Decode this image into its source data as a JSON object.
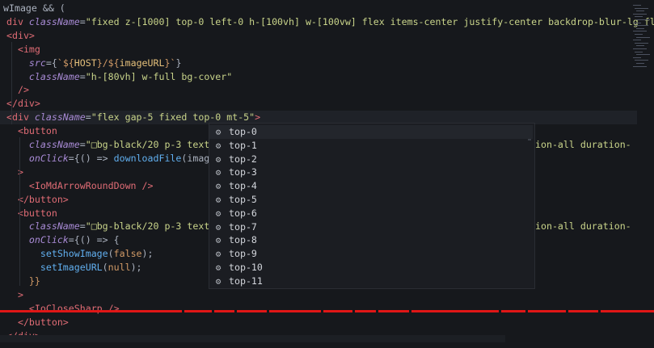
{
  "editor": {
    "lines": [
      [
        [
          "wImage && (",
          "punc"
        ]
      ],
      [
        [
          "div ",
          "tag"
        ],
        [
          "className",
          "attr"
        ],
        [
          "=",
          "punc"
        ],
        [
          "\"fixed z-[1000] top-0 left-0 h-[100vh] w-[100vw] flex items-center justify-center backdrop-blur-lg fl",
          "str"
        ]
      ],
      [
        [
          "<div>",
          "tag"
        ]
      ],
      [
        [
          "  <img",
          "tag"
        ]
      ],
      [
        [
          "    src",
          "attr"
        ],
        [
          "={",
          "punc"
        ],
        [
          "`${",
          "brace"
        ],
        [
          "HOST",
          "var"
        ],
        [
          "}/${",
          "brace"
        ],
        [
          "imageURL",
          "var"
        ],
        [
          "}`",
          "brace"
        ],
        [
          "}",
          "punc"
        ]
      ],
      [
        [
          "    className",
          "attr"
        ],
        [
          "=",
          "punc"
        ],
        [
          "\"h-[80vh] w-full bg-cover\"",
          "str"
        ]
      ],
      [
        [
          "  />",
          "tag"
        ]
      ],
      [
        [
          "</div>",
          "tag"
        ]
      ],
      [
        [
          "<div ",
          "tag"
        ],
        [
          "className",
          "attr"
        ],
        [
          "=",
          "punc"
        ],
        [
          "\"flex gap-5 fixed top-0 mt-5\"",
          "str"
        ],
        [
          ">",
          "tag"
        ]
      ],
      [
        [
          "  <button",
          "tag"
        ]
      ],
      [
        [
          "    className",
          "attr"
        ],
        [
          "=",
          "punc"
        ],
        [
          "\"□bg-black/20 p-3 text",
          "str"
        ]
      ],
      [
        [
          "    onClick",
          "attr"
        ],
        [
          "={() => ",
          "punc"
        ],
        [
          "downloadFile",
          "fn"
        ],
        [
          "(image",
          "punc"
        ]
      ],
      [
        [
          "  >",
          "tag"
        ]
      ],
      [
        [
          "    <IoMdArrowRoundDown />",
          "tag"
        ]
      ],
      [
        [
          "  </button>",
          "tag"
        ]
      ],
      [
        [
          "  <button",
          "tag"
        ]
      ],
      [
        [
          "    className",
          "attr"
        ],
        [
          "=",
          "punc"
        ],
        [
          "\"□bg-black/20 p-3 text",
          "str"
        ]
      ],
      [
        [
          "    onClick",
          "attr"
        ],
        [
          "={() => {",
          "punc"
        ]
      ],
      [
        [
          "      setShowImage",
          "fn"
        ],
        [
          "(",
          "punc"
        ],
        [
          "false",
          "bool"
        ],
        [
          ");",
          "punc"
        ]
      ],
      [
        [
          "      setImageURL",
          "fn"
        ],
        [
          "(",
          "punc"
        ],
        [
          "null",
          "null"
        ],
        [
          ");",
          "punc"
        ]
      ],
      [
        [
          "    }}",
          "brace"
        ]
      ],
      [
        [
          "  >",
          "tag"
        ]
      ],
      [
        [
          "    <IoCloseSharp />",
          "tag"
        ]
      ],
      [
        [
          "  </button>",
          "tag"
        ]
      ],
      [
        [
          "</div>",
          "tag"
        ]
      ]
    ],
    "right_fragments": [
      {
        "line": 10,
        "text": "ion-all duration-"
      },
      {
        "line": 16,
        "text": "ion-all duration-"
      }
    ],
    "current_line": 8
  },
  "autocomplete": {
    "items": [
      "top-0",
      "top-1",
      "top-2",
      "top-3",
      "top-4",
      "top-5",
      "top-6",
      "top-7",
      "top-8",
      "top-9",
      "top-10",
      "top-11"
    ],
    "selected_index": 0,
    "item_icon": "gear-icon"
  },
  "colors": {
    "background": "#16181c",
    "red_line": "#e01616"
  }
}
